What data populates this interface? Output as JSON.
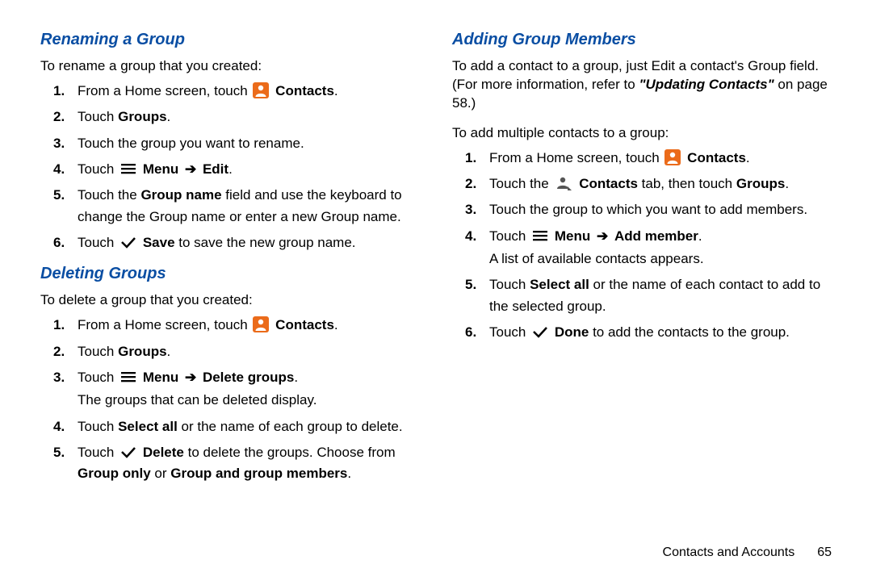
{
  "left": {
    "section1": {
      "heading": "Renaming a Group",
      "intro": "To rename a group that you created:",
      "s1a": "From a Home screen, touch",
      "s1b": "Contacts",
      "s1c": ".",
      "s2a": "Touch ",
      "s2b": "Groups",
      "s2c": ".",
      "s3": "Touch the group you want to rename.",
      "s4a": "Touch",
      "s4b": "Menu",
      "s4c": "Edit",
      "s4d": ".",
      "s5a": "Touch the ",
      "s5b": "Group name",
      "s5c": " field and use the keyboard to change the Group name or enter a new Group name.",
      "s6a": "Touch",
      "s6b": "Save",
      "s6c": " to save the new group name."
    },
    "section2": {
      "heading": "Deleting Groups",
      "intro": "To delete a group that you created:",
      "s1a": "From a Home screen, touch",
      "s1b": "Contacts",
      "s1c": ".",
      "s2a": "Touch ",
      "s2b": "Groups",
      "s2c": ".",
      "s3a": "Touch",
      "s3b": "Menu",
      "s3c": "Delete groups",
      "s3d": ".",
      "s3sub": "The groups that can be deleted display.",
      "s4a": "Touch ",
      "s4b": "Select all",
      "s4c": " or the name of each group to delete.",
      "s5a": "Touch",
      "s5b": "Delete",
      "s5c": " to delete the groups. Choose from ",
      "s5d": "Group only",
      "s5e": " or ",
      "s5f": "Group and group members",
      "s5g": "."
    }
  },
  "right": {
    "section1": {
      "heading": "Adding Group Members",
      "intro1a": "To add a contact to a group, just Edit a contact's Group field. (For more information, refer to ",
      "intro1b": "\"Updating Contacts\"",
      "intro1c": "  on page 58.)",
      "intro2": "To add multiple contacts to a group:",
      "s1a": "From a Home screen, touch",
      "s1b": "Contacts",
      "s1c": ".",
      "s2a": "Touch the",
      "s2b": "Contacts",
      "s2c": " tab, then touch ",
      "s2d": "Groups",
      "s2e": ".",
      "s3": "Touch the group to which you want to add members.",
      "s4a": "Touch",
      "s4b": "Menu",
      "s4c": "Add member",
      "s4d": ".",
      "s4sub": "A list of available contacts appears.",
      "s5a": "Touch ",
      "s5b": "Select all",
      "s5c": " or the name of each contact to add to the selected group.",
      "s6a": "Touch",
      "s6b": "Done",
      "s6c": " to add the contacts to the group."
    }
  },
  "footer": {
    "chapter": "Contacts and Accounts",
    "page": "65"
  },
  "arrow": "➔"
}
